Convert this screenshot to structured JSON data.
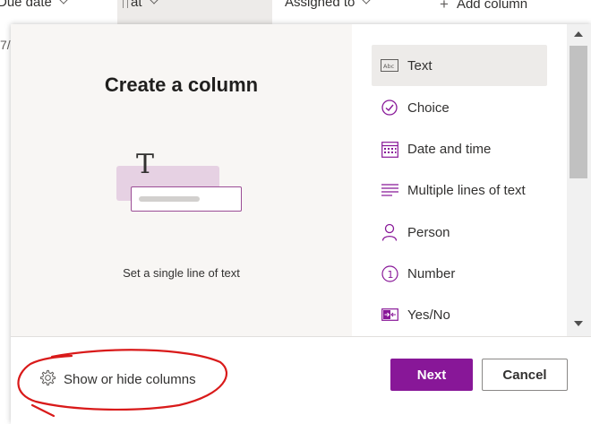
{
  "header": {
    "col_due": "Due date",
    "col_status": "at",
    "col_assigned": "Assigned to",
    "add_column": "Add column",
    "row_fragment": "7/"
  },
  "panel": {
    "title": "Create a column",
    "preview_description": "Set a single line of text",
    "types": [
      {
        "label": "Text",
        "icon": "text-field-icon",
        "selected": true
      },
      {
        "label": "Choice",
        "icon": "choice-check-icon"
      },
      {
        "label": "Date and time",
        "icon": "calendar-icon"
      },
      {
        "label": "Multiple lines of text",
        "icon": "multiline-text-icon"
      },
      {
        "label": "Person",
        "icon": "person-icon"
      },
      {
        "label": "Number",
        "icon": "number-icon"
      },
      {
        "label": "Yes/No",
        "icon": "yes-no-icon"
      }
    ]
  },
  "footer": {
    "show_hide_label": "Show or hide columns",
    "next_label": "Next",
    "cancel_label": "Cancel"
  },
  "colors": {
    "accent": "#881798",
    "selected_bg": "#edebe9",
    "annotation": "#d91a1a"
  }
}
